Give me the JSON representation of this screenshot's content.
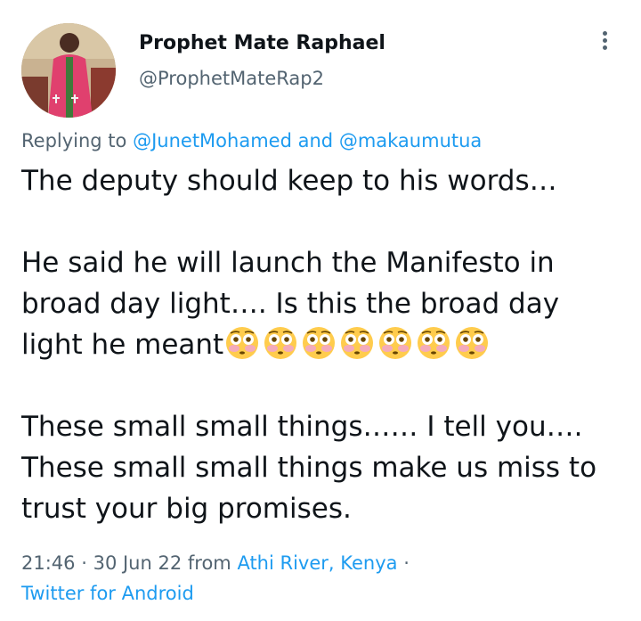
{
  "author": {
    "display_name": "Prophet Mate Raphael",
    "handle": "@ProphetMateRap2",
    "avatar_icon": "profile-photo"
  },
  "more_icon": "vertical-ellipsis-icon",
  "reply": {
    "prefix": "Replying to",
    "user1": "@JunetMohamed",
    "conjunction": "and",
    "user2": "@makaumutua"
  },
  "tweet": {
    "line1": "The deputy should keep to his words…",
    "line2": "He said he will launch the Manifesto in",
    "line3": "broad day light…. Is this the broad day",
    "line4": "light he meant",
    "emoji_name": "flushed-face-emoji",
    "emoji_count": 7,
    "line5": "These small small things…… I tell you….",
    "line6": "These small small things make us miss to",
    "line7": "trust your big promises."
  },
  "meta": {
    "time": "21:46",
    "date": "30 Jun 22",
    "from_text": "from",
    "location": "Athi River, Kenya",
    "separator": "·",
    "source": "Twitter for Android"
  },
  "colors": {
    "text": "#0f1419",
    "secondary": "#536471",
    "link": "#1d9bf0"
  }
}
